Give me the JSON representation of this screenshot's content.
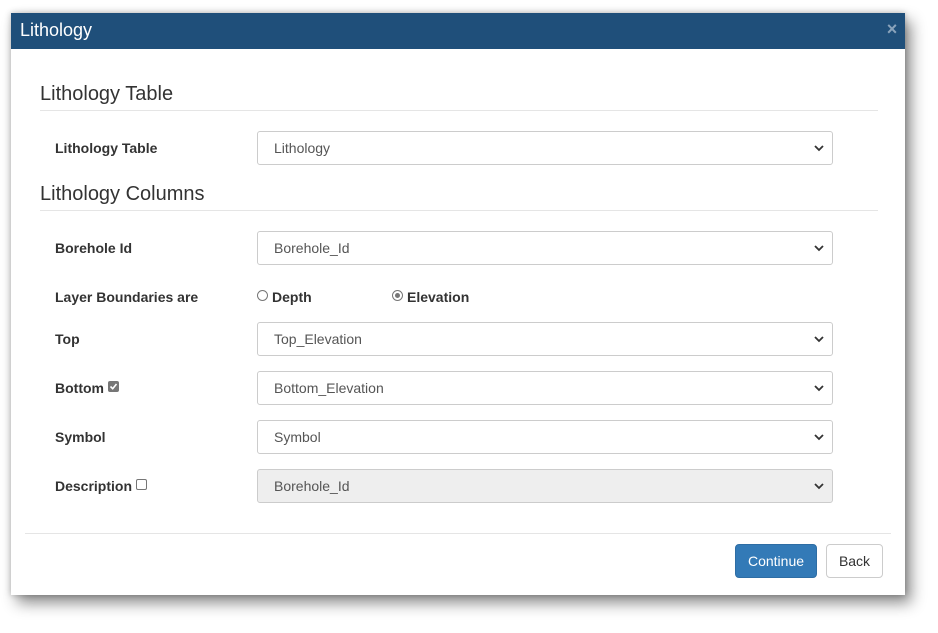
{
  "dialog": {
    "title": "Lithology",
    "close_symbol": "×",
    "close_icon": "close-icon"
  },
  "table_section": {
    "heading": "Lithology Table",
    "field_label": "Lithology Table",
    "field_value": "Lithology"
  },
  "columns_section": {
    "heading": "Lithology Columns",
    "borehole": {
      "label": "Borehole Id",
      "value": "Borehole_Id"
    },
    "layer_boundaries": {
      "label": "Layer Boundaries are",
      "options": [
        {
          "label": "Depth",
          "selected": false
        },
        {
          "label": "Elevation",
          "selected": true
        }
      ]
    },
    "top": {
      "label": "Top",
      "value": "Top_Elevation"
    },
    "bottom": {
      "label": "Bottom",
      "checked": true,
      "value": "Bottom_Elevation"
    },
    "symbol": {
      "label": "Symbol",
      "value": "Symbol"
    },
    "description": {
      "label": "Description",
      "checked": false,
      "value": "Borehole_Id",
      "disabled": true
    }
  },
  "footer": {
    "continue_label": "Continue",
    "back_label": "Back"
  },
  "colors": {
    "titlebar": "#1f4f7a",
    "primary": "#337ab7",
    "disabled_bg": "#eeeeee"
  }
}
